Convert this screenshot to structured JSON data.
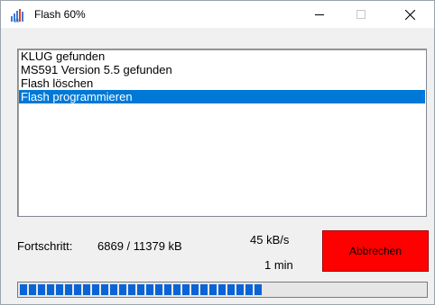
{
  "window": {
    "title": "Flash 60%",
    "icon": "flash-app-icon",
    "controls": {
      "minimize": "minimize-icon",
      "maximize": "maximize-icon",
      "close": "close-icon"
    }
  },
  "log": {
    "items": [
      {
        "text": "KLUG gefunden",
        "selected": false
      },
      {
        "text": "MS591 Version 5.5 gefunden",
        "selected": false
      },
      {
        "text": "Flash löschen",
        "selected": false
      },
      {
        "text": "Flash programmieren",
        "selected": true
      }
    ],
    "selected_color": "#0078d7"
  },
  "status": {
    "progress_label": "Fortschritt:",
    "transferred": "6869 / 11379 kB",
    "speed": "45 kB/s",
    "remaining": "1 min"
  },
  "abort_button": {
    "label": "Abbrechen",
    "color": "#ff0000"
  },
  "progress_bar": {
    "fraction": 0.6,
    "color": "#0a64d6"
  }
}
